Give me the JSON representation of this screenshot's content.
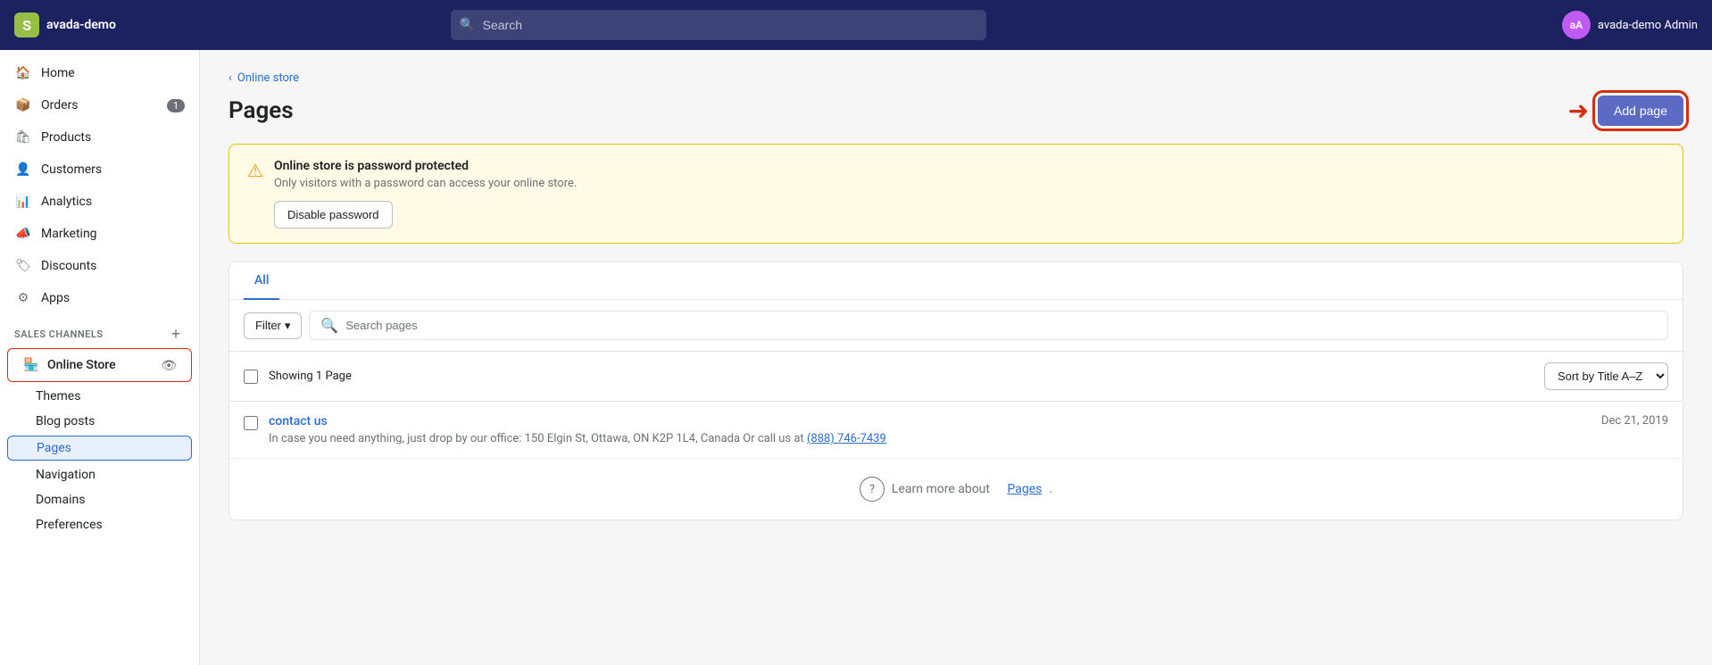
{
  "topnav": {
    "brand": "avada-demo",
    "logo_letter": "S",
    "search_placeholder": "Search",
    "user_initials": "aA",
    "username": "avada-demo Admin"
  },
  "sidebar": {
    "items": [
      {
        "id": "home",
        "label": "Home",
        "icon": "home"
      },
      {
        "id": "orders",
        "label": "Orders",
        "icon": "orders",
        "badge": "1"
      },
      {
        "id": "products",
        "label": "Products",
        "icon": "products"
      },
      {
        "id": "customers",
        "label": "Customers",
        "icon": "customers"
      },
      {
        "id": "analytics",
        "label": "Analytics",
        "icon": "analytics"
      },
      {
        "id": "marketing",
        "label": "Marketing",
        "icon": "marketing"
      },
      {
        "id": "discounts",
        "label": "Discounts",
        "icon": "discounts"
      },
      {
        "id": "apps",
        "label": "Apps",
        "icon": "apps"
      }
    ],
    "sales_channels_title": "SALES CHANNELS",
    "online_store_label": "Online Store",
    "sub_items": [
      {
        "id": "themes",
        "label": "Themes"
      },
      {
        "id": "blog-posts",
        "label": "Blog posts"
      },
      {
        "id": "pages",
        "label": "Pages",
        "active": true
      },
      {
        "id": "navigation",
        "label": "Navigation"
      },
      {
        "id": "domains",
        "label": "Domains"
      },
      {
        "id": "preferences",
        "label": "Preferences"
      }
    ]
  },
  "breadcrumb": {
    "parent": "Online store"
  },
  "page": {
    "title": "Pages",
    "add_button_label": "Add page"
  },
  "warning": {
    "title": "Online store is password protected",
    "description": "Only visitors with a password can access your online store.",
    "button_label": "Disable password"
  },
  "tabs": [
    {
      "id": "all",
      "label": "All",
      "active": true
    }
  ],
  "filter": {
    "filter_label": "Filter",
    "search_placeholder": "Search pages"
  },
  "table": {
    "showing_text": "Showing 1 Page",
    "sort_label": "Sort by Title A–Z",
    "rows": [
      {
        "id": "contact-us",
        "title": "contact us",
        "description": "In case you need anything, just drop by our office: 150 Elgin St, Ottawa, ON K2P 1L4, Canada Or call us at",
        "phone": "(888) 746-7439",
        "date": "Dec 21, 2019"
      }
    ]
  },
  "learn_more": {
    "text_before": "Learn more about",
    "link_text": "Pages",
    "text_after": "."
  }
}
